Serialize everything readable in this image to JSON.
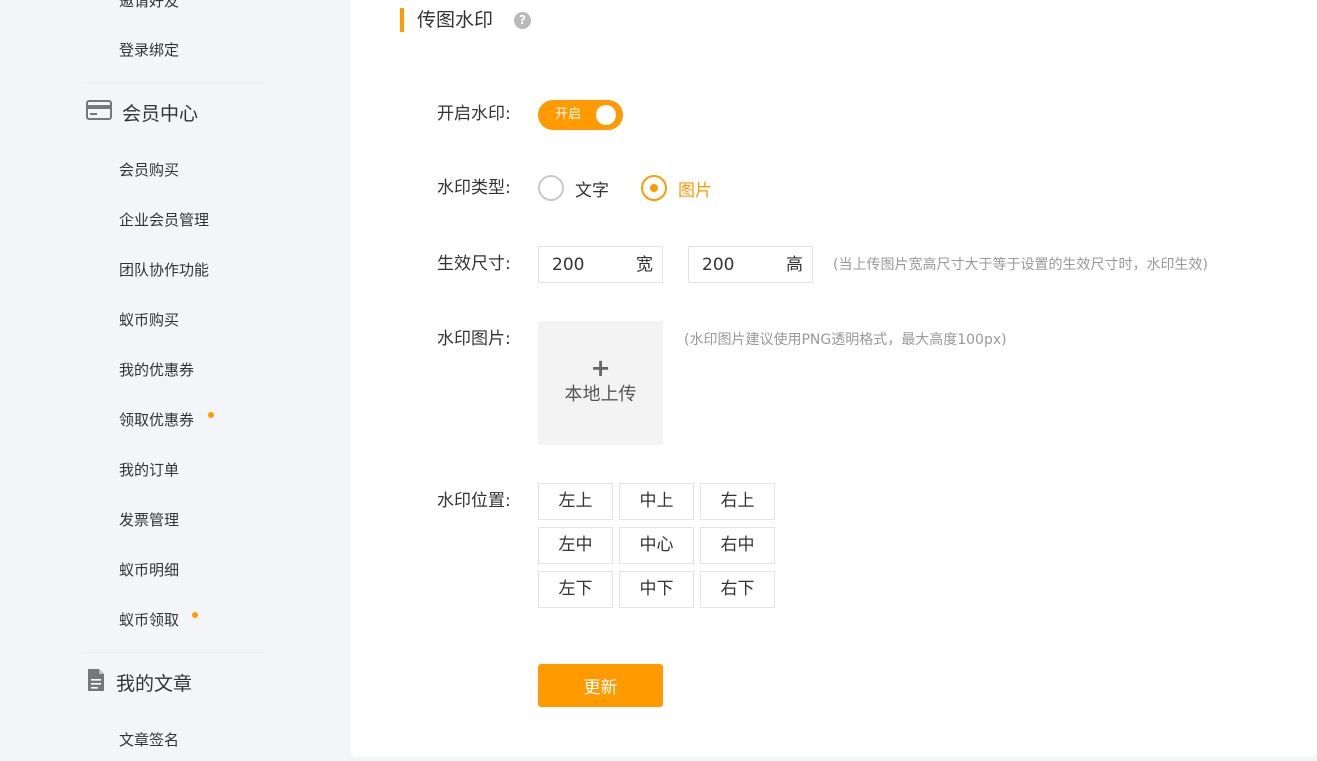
{
  "sidebar": {
    "top_items": [
      {
        "label": "邀请好友"
      },
      {
        "label": "登录绑定"
      }
    ],
    "member_center": {
      "title": "会员中心",
      "icon": "card-icon",
      "items": [
        {
          "label": "会员购买"
        },
        {
          "label": "企业会员管理"
        },
        {
          "label": "团队协作功能"
        },
        {
          "label": "蚁币购买"
        },
        {
          "label": "我的优惠券"
        },
        {
          "label": "领取优惠券",
          "has_dot": true
        },
        {
          "label": "我的订单"
        },
        {
          "label": "发票管理"
        },
        {
          "label": "蚁币明细"
        },
        {
          "label": "蚁币领取",
          "has_dot": true
        }
      ]
    },
    "my_articles": {
      "title": "我的文章",
      "icon": "document-icon",
      "items": [
        {
          "label": "文章签名"
        }
      ]
    },
    "dot_color": "#ff9a00"
  },
  "main": {
    "title": "传图水印",
    "help_icon_text": "?",
    "enable": {
      "label": "开启水印:",
      "toggle_text": "开启",
      "on": true
    },
    "type": {
      "label": "水印类型:",
      "options": [
        {
          "label": "文字",
          "checked": false
        },
        {
          "label": "图片",
          "checked": true
        }
      ]
    },
    "size": {
      "label": "生效尺寸:",
      "width_value": "200",
      "width_unit": "宽",
      "height_value": "200",
      "height_unit": "高",
      "hint": "(当上传图片宽高尺寸大于等于设置的生效尺寸时，水印生效)"
    },
    "image": {
      "label": "水印图片:",
      "upload_plus": "+",
      "upload_text": "本地上传",
      "hint": "(水印图片建议使用PNG透明格式，最大高度100px)"
    },
    "position": {
      "label": "水印位置:",
      "cells": [
        "左上",
        "中上",
        "右上",
        "左中",
        "中心",
        "右中",
        "左下",
        "中下",
        "右下"
      ]
    },
    "submit_label": "更新"
  },
  "colors": {
    "accent": "#ff9a00",
    "background": "#f4f5f8",
    "panel": "#ffffff",
    "hint_text": "#999999"
  }
}
